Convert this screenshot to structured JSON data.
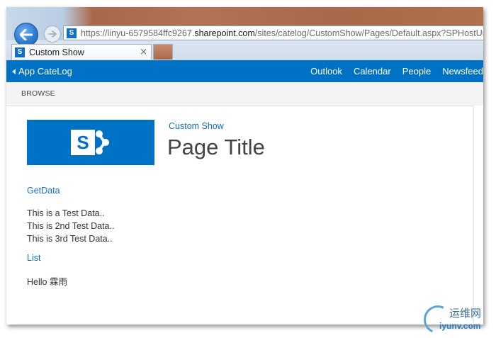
{
  "browser": {
    "url_prefix": "https://linyu-6579584ffc9267.",
    "url_host": "sharepoint.com",
    "url_rest": "/sites/catelog/CustomShow/Pages/Default.aspx?SPHostUrl=ht",
    "tab_title": "Custom Show",
    "tab_close": "×"
  },
  "suitebar": {
    "app_link": "App CateLog",
    "nav": [
      "Outlook",
      "Calendar",
      "People",
      "Newsfeed"
    ]
  },
  "ribbon": {
    "tab": "BROWSE"
  },
  "page": {
    "site_title": "Custom Show",
    "page_title": "Page Title",
    "getdata_link": "GetData",
    "data_lines": [
      "This is a Test Data..",
      "This is 2nd Test Data..",
      "This is 3rd Test Data.."
    ],
    "list_link": "List",
    "hello": "Hello 霖雨"
  },
  "watermark": {
    "cn": "运维网",
    "url": "iyunv.com"
  },
  "colors": {
    "suite_blue": "#0072c6",
    "link_blue": "#0f6fc6",
    "ribbon_bg": "#f4f4f4"
  },
  "icons": [
    "back-arrow-icon",
    "forward-arrow-icon",
    "sharepoint-icon"
  ]
}
